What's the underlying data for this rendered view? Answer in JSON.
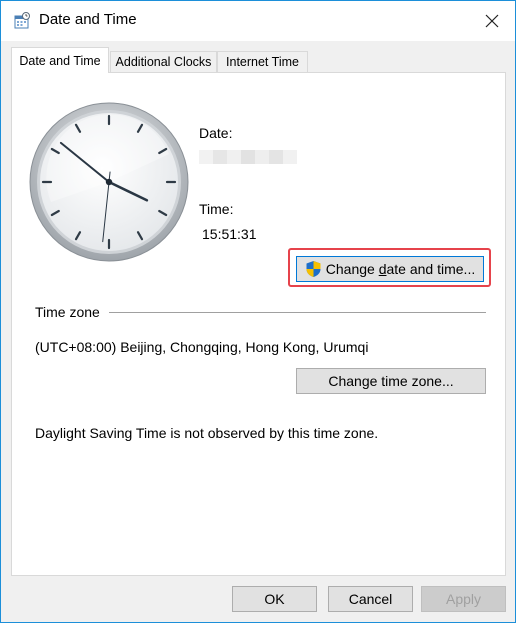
{
  "window": {
    "title": "Date and Time",
    "title_icon": "date-time-control-panel-icon"
  },
  "tabs": [
    {
      "label": "Date and Time"
    },
    {
      "label": "Additional Clocks"
    },
    {
      "label": "Internet Time"
    }
  ],
  "date_time": {
    "date_label": "Date:",
    "time_label": "Time:",
    "time_value": "15:51:31",
    "change_button_pre": "Change ",
    "change_button_accel": "d",
    "change_button_post": "ate and time...",
    "clock": {
      "hour": 15,
      "minute": 51,
      "second": 31
    }
  },
  "time_zone": {
    "section_label": "Time zone",
    "value": "(UTC+08:00) Beijing, Chongqing, Hong Kong, Urumqi",
    "change_button": "Change time zone...",
    "dst_note": "Daylight Saving Time is not observed by this time zone."
  },
  "footer": {
    "ok": "OK",
    "cancel": "Cancel",
    "apply": "Apply"
  },
  "colors": {
    "highlight_border": "#e6434b",
    "window_border": "#1c8fd9",
    "focus_border": "#0078d7"
  }
}
